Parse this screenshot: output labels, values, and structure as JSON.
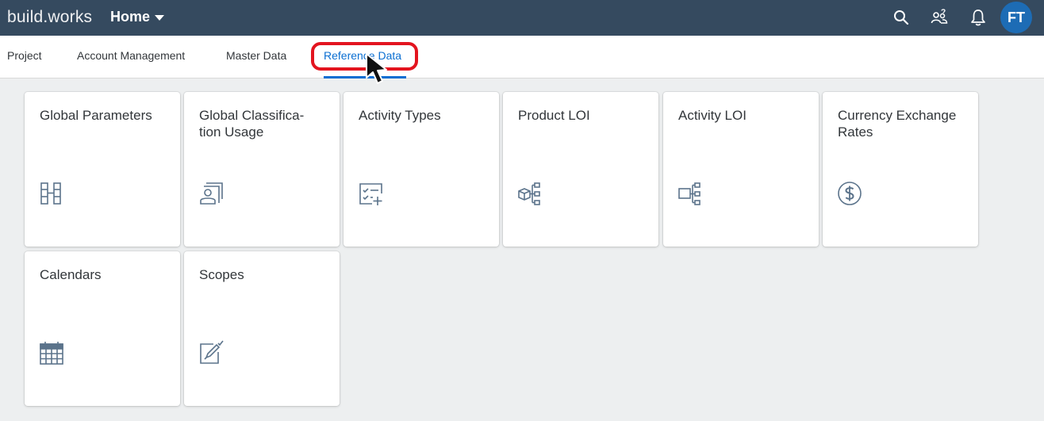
{
  "shell": {
    "brand_part1": "build",
    "brand_dot": ".",
    "brand_part2": "works",
    "title": "Home",
    "icons": [
      "search-icon",
      "people-icon",
      "bell-icon"
    ],
    "avatar_initials": "FT",
    "avatar_color": "#1d6cb5",
    "bar_color": "#354a5f"
  },
  "tabs": [
    {
      "label": "Project"
    },
    {
      "label": "Account Management"
    },
    {
      "label": "Master Data"
    },
    {
      "label": "Reference Data",
      "active": true
    }
  ],
  "tiles": [
    {
      "title": "Global Parameters",
      "icon": "parameters-icon"
    },
    {
      "title": "Global Classifica- tion Usage",
      "icon": "user-documents-icon"
    },
    {
      "title": "Activity Types",
      "icon": "checklist-add-icon"
    },
    {
      "title": "Product LOI",
      "icon": "product-hierarchy-icon"
    },
    {
      "title": "Activity LOI",
      "icon": "hierarchy-icon"
    },
    {
      "title": "Currency Exchange Rates",
      "icon": "currency-icon"
    },
    {
      "title": "Calendars",
      "icon": "calendar-icon"
    },
    {
      "title": "Scopes",
      "icon": "edit-form-icon"
    }
  ],
  "colors": {
    "accent": "#0a6ed1",
    "highlight": "#e3141f",
    "icon": "#5b738b"
  }
}
